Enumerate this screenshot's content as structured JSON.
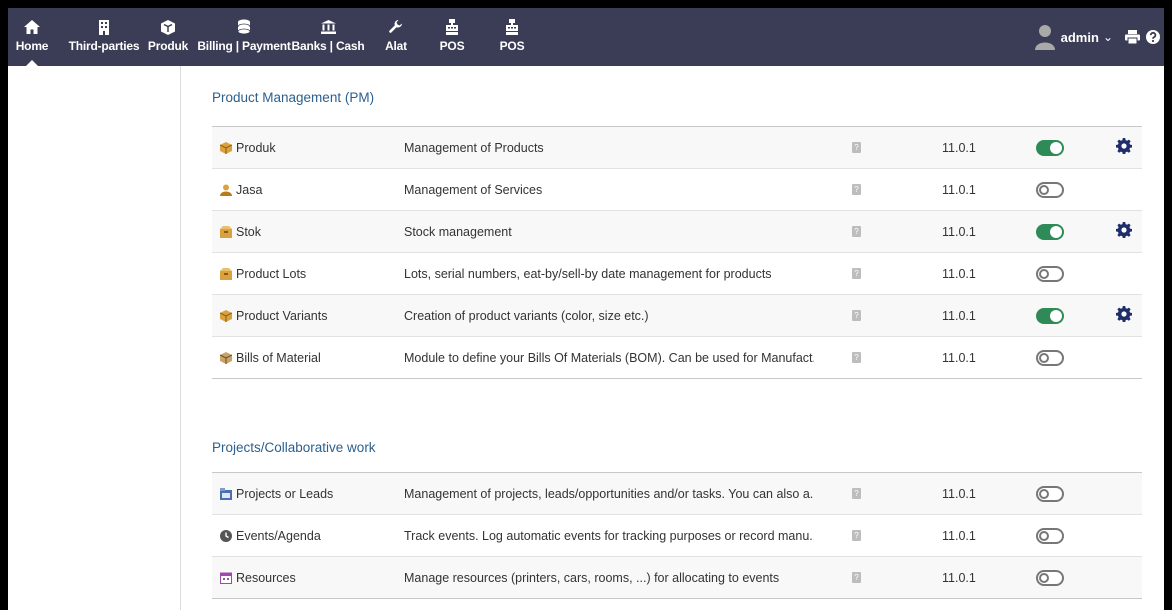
{
  "nav": {
    "items": [
      {
        "label": "Home",
        "icon": "home-icon"
      },
      {
        "label": "Third-parties",
        "icon": "building-icon"
      },
      {
        "label": "Produk",
        "icon": "cube-icon"
      },
      {
        "label": "Billing | Payment",
        "icon": "coins-icon"
      },
      {
        "label": "Banks | Cash",
        "icon": "bank-icon"
      },
      {
        "label": "Alat",
        "icon": "wrench-icon"
      },
      {
        "label": "POS",
        "icon": "cash-register-icon"
      },
      {
        "label": "POS",
        "icon": "cash-register-icon"
      }
    ],
    "user": "admin",
    "chevron": "⌄"
  },
  "colors": {
    "topbar": "#3b3c55",
    "section_title": "#2c5f8d",
    "toggle_on": "#2e8b57",
    "gear": "#1f2d6b"
  },
  "sections": [
    {
      "title": "Product Management (PM)",
      "modules": [
        {
          "name": "Produk",
          "description": "Management of Products",
          "version": "11.0.1",
          "enabled": true,
          "settings": true
        },
        {
          "name": "Jasa",
          "description": "Management of Services",
          "version": "11.0.1",
          "enabled": false,
          "settings": false
        },
        {
          "name": "Stok",
          "description": "Stock management",
          "version": "11.0.1",
          "enabled": true,
          "settings": true
        },
        {
          "name": "Product Lots",
          "description": "Lots, serial numbers, eat-by/sell-by date management for products",
          "version": "11.0.1",
          "enabled": false,
          "settings": false
        },
        {
          "name": "Product Variants",
          "description": "Creation of product variants (color, size etc.)",
          "version": "11.0.1",
          "enabled": true,
          "settings": true
        },
        {
          "name": "Bills of Material",
          "description": "Module to define your Bills Of Materials (BOM). Can be used for Manufact...",
          "version": "11.0.1",
          "enabled": false,
          "settings": false
        }
      ]
    },
    {
      "title": "Projects/Collaborative work",
      "modules": [
        {
          "name": "Projects or Leads",
          "description": "Management of projects, leads/opportunities and/or tasks. You can also a...",
          "version": "11.0.1",
          "enabled": false,
          "settings": false
        },
        {
          "name": "Events/Agenda",
          "description": "Track events. Log automatic events for tracking purposes or record manu...",
          "version": "11.0.1",
          "enabled": false,
          "settings": false
        },
        {
          "name": "Resources",
          "description": "Manage resources (printers, cars, rooms, ...) for allocating to events",
          "version": "11.0.1",
          "enabled": false,
          "settings": false
        }
      ]
    }
  ]
}
